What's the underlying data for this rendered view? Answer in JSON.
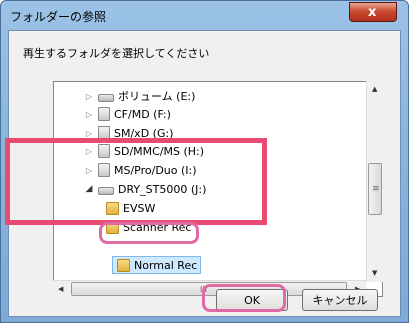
{
  "window": {
    "title": "フォルダーの参照",
    "close_label": "x"
  },
  "instruction": "再生するフォルダを選択してください",
  "tree": [
    {
      "label": "ボリューム (E:)",
      "icon": "drive-icon",
      "expander": "▷"
    },
    {
      "label": "CF/MD (F:)",
      "icon": "card-icon",
      "expander": "▷"
    },
    {
      "label": "SM/xD (G:)",
      "icon": "card-icon",
      "expander": "▷"
    },
    {
      "label": "SD/MMC/MS (H:)",
      "icon": "card-icon",
      "expander": "▷"
    },
    {
      "label": "MS/Pro/Duo (I:)",
      "icon": "card-icon",
      "expander": "▷"
    },
    {
      "label": "DRY_ST5000 (J:)",
      "icon": "drive-icon",
      "expander": "◢"
    },
    {
      "label": "EVSW",
      "icon": "folder-icon",
      "expander": ""
    },
    {
      "label": "Scanner Rec",
      "icon": "folder-icon",
      "expander": ""
    },
    {
      "label": "Normal Rec",
      "icon": "folder-icon",
      "expander": ""
    }
  ],
  "scroll": {
    "up": "▲",
    "down": "▼",
    "left": "◀",
    "right": "▶",
    "thumb_grip": "≡",
    "hgrip": "III"
  },
  "buttons": {
    "ok": "OK",
    "cancel": "キャンセル"
  },
  "colors": {
    "highlight": "#e94a72",
    "selection": "#cde8ff"
  }
}
